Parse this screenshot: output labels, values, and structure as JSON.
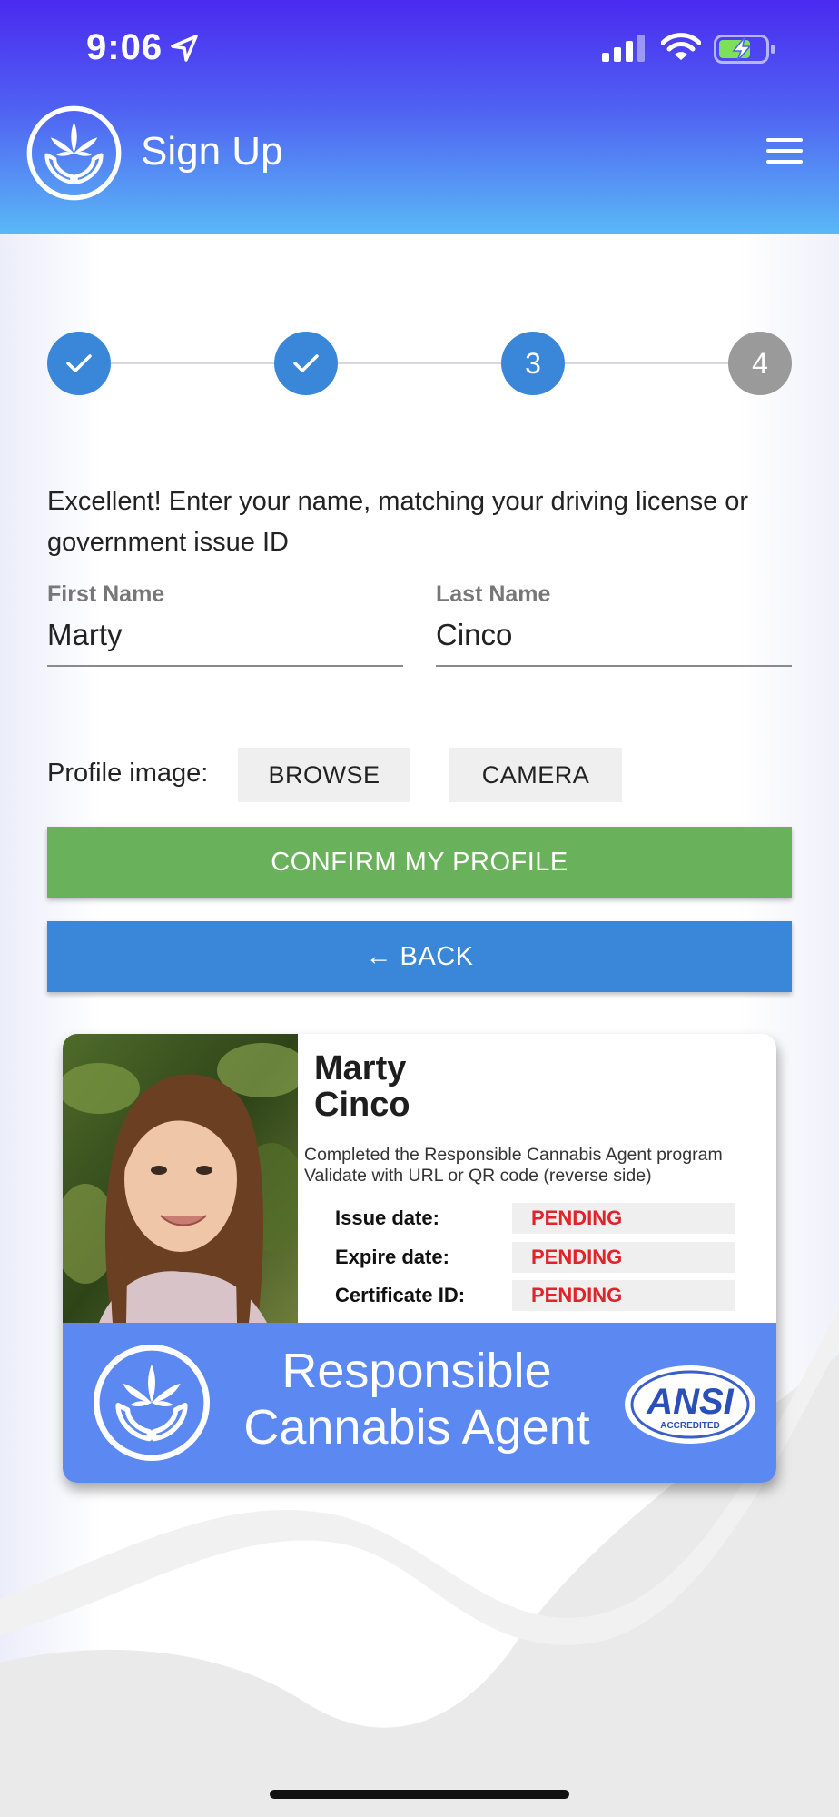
{
  "status_bar": {
    "time": "9:06"
  },
  "header": {
    "title": "Sign Up"
  },
  "stepper": {
    "steps": [
      {
        "label": "",
        "state": "complete"
      },
      {
        "label": "",
        "state": "complete"
      },
      {
        "label": "3",
        "state": "current"
      },
      {
        "label": "4",
        "state": "pending"
      }
    ]
  },
  "form": {
    "instructions": "Excellent! Enter your name, matching your driving license or government issue ID",
    "first_name": {
      "label": "First Name",
      "value": "Marty"
    },
    "last_name": {
      "label": "Last Name",
      "value": "Cinco"
    },
    "profile_image_label": "Profile image:",
    "browse_label": "BROWSE",
    "camera_label": "CAMERA",
    "confirm_label": "CONFIRM MY PROFILE",
    "back_label": "← BACK"
  },
  "card": {
    "first_name": "Marty",
    "last_name": "Cinco",
    "description_line1": "Completed the Responsible Cannabis Agent program",
    "description_line2": "Validate with URL or QR code (reverse side)",
    "rows": [
      {
        "label": "Issue date:",
        "value": "PENDING"
      },
      {
        "label": "Expire date:",
        "value": "PENDING"
      },
      {
        "label": "Certificate ID:",
        "value": "PENDING"
      }
    ],
    "banner_line1": "Responsible",
    "banner_line2": "Cannabis Agent",
    "badge_text": "ANSI",
    "badge_subtext": "ACCREDITED"
  },
  "colors": {
    "header_top": "#4a2af0",
    "header_bottom": "#5ab8f6",
    "step_active": "#3a87d9",
    "step_inactive": "#9a9a9a",
    "confirm": "#6ab15c",
    "back": "#3a87d9",
    "pending_text": "#e0242a",
    "banner": "#5c88f2"
  }
}
